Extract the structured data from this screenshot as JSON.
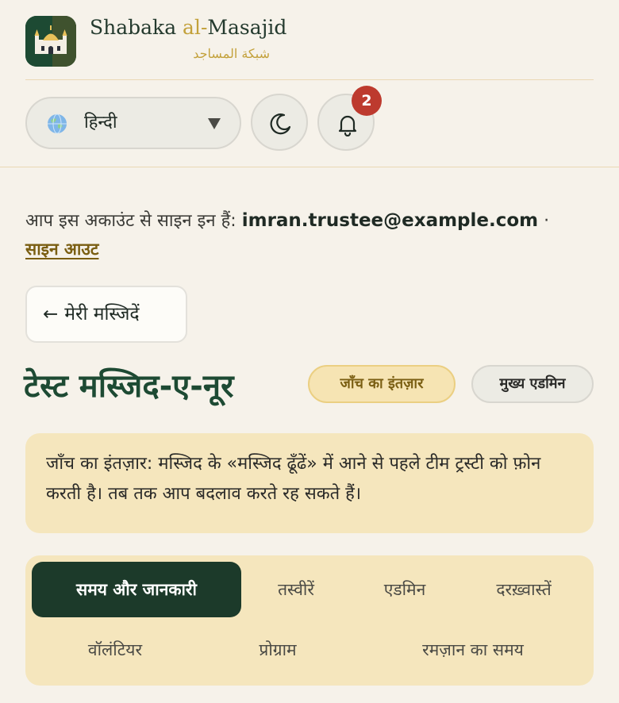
{
  "header": {
    "brand_en_pre": "Shabaka ",
    "brand_en_accent": "al-",
    "brand_en_post": "Masajid",
    "brand_ar": "شبكة المساجد"
  },
  "controls": {
    "language_label": "हिन्दी",
    "notification_count": "2"
  },
  "account": {
    "signed_in_prefix": "आप इस अकाउंट से साइन इन हैं: ",
    "email": "imran.trustee@example.com",
    "separator": " ·",
    "sign_out_label": "साइन आउट"
  },
  "nav": {
    "back_label": "मेरी मस्जिदें"
  },
  "mosque": {
    "name": "टेस्ट मस्जिद-ए-नूर",
    "status_label": "जाँच का इंतज़ार",
    "role_label": "मुख्य एडमिन",
    "notice": "जाँच का इंतज़ार: मस्जिद के «मस्जिद ढूँढें» में आने से पहले टीम ट्रस्टी को फ़ोन करती है। तब तक आप बदलाव करते रह सकते हैं।"
  },
  "tabs": [
    {
      "label": "समय और जानकारी",
      "active": true
    },
    {
      "label": "तस्वीरें",
      "active": false
    },
    {
      "label": "एडमिन",
      "active": false
    },
    {
      "label": "दरख़्वास्तें",
      "active": false
    },
    {
      "label": "वॉलंटियर",
      "active": false
    },
    {
      "label": "प्रोग्राम",
      "active": false
    },
    {
      "label": "रमज़ान का समय",
      "active": false
    }
  ],
  "colors": {
    "brand_green": "#1d4a33",
    "accent_gold": "#c3a13b",
    "notice_bg": "#f5e6bd",
    "badge_red": "#bd3a2e"
  }
}
